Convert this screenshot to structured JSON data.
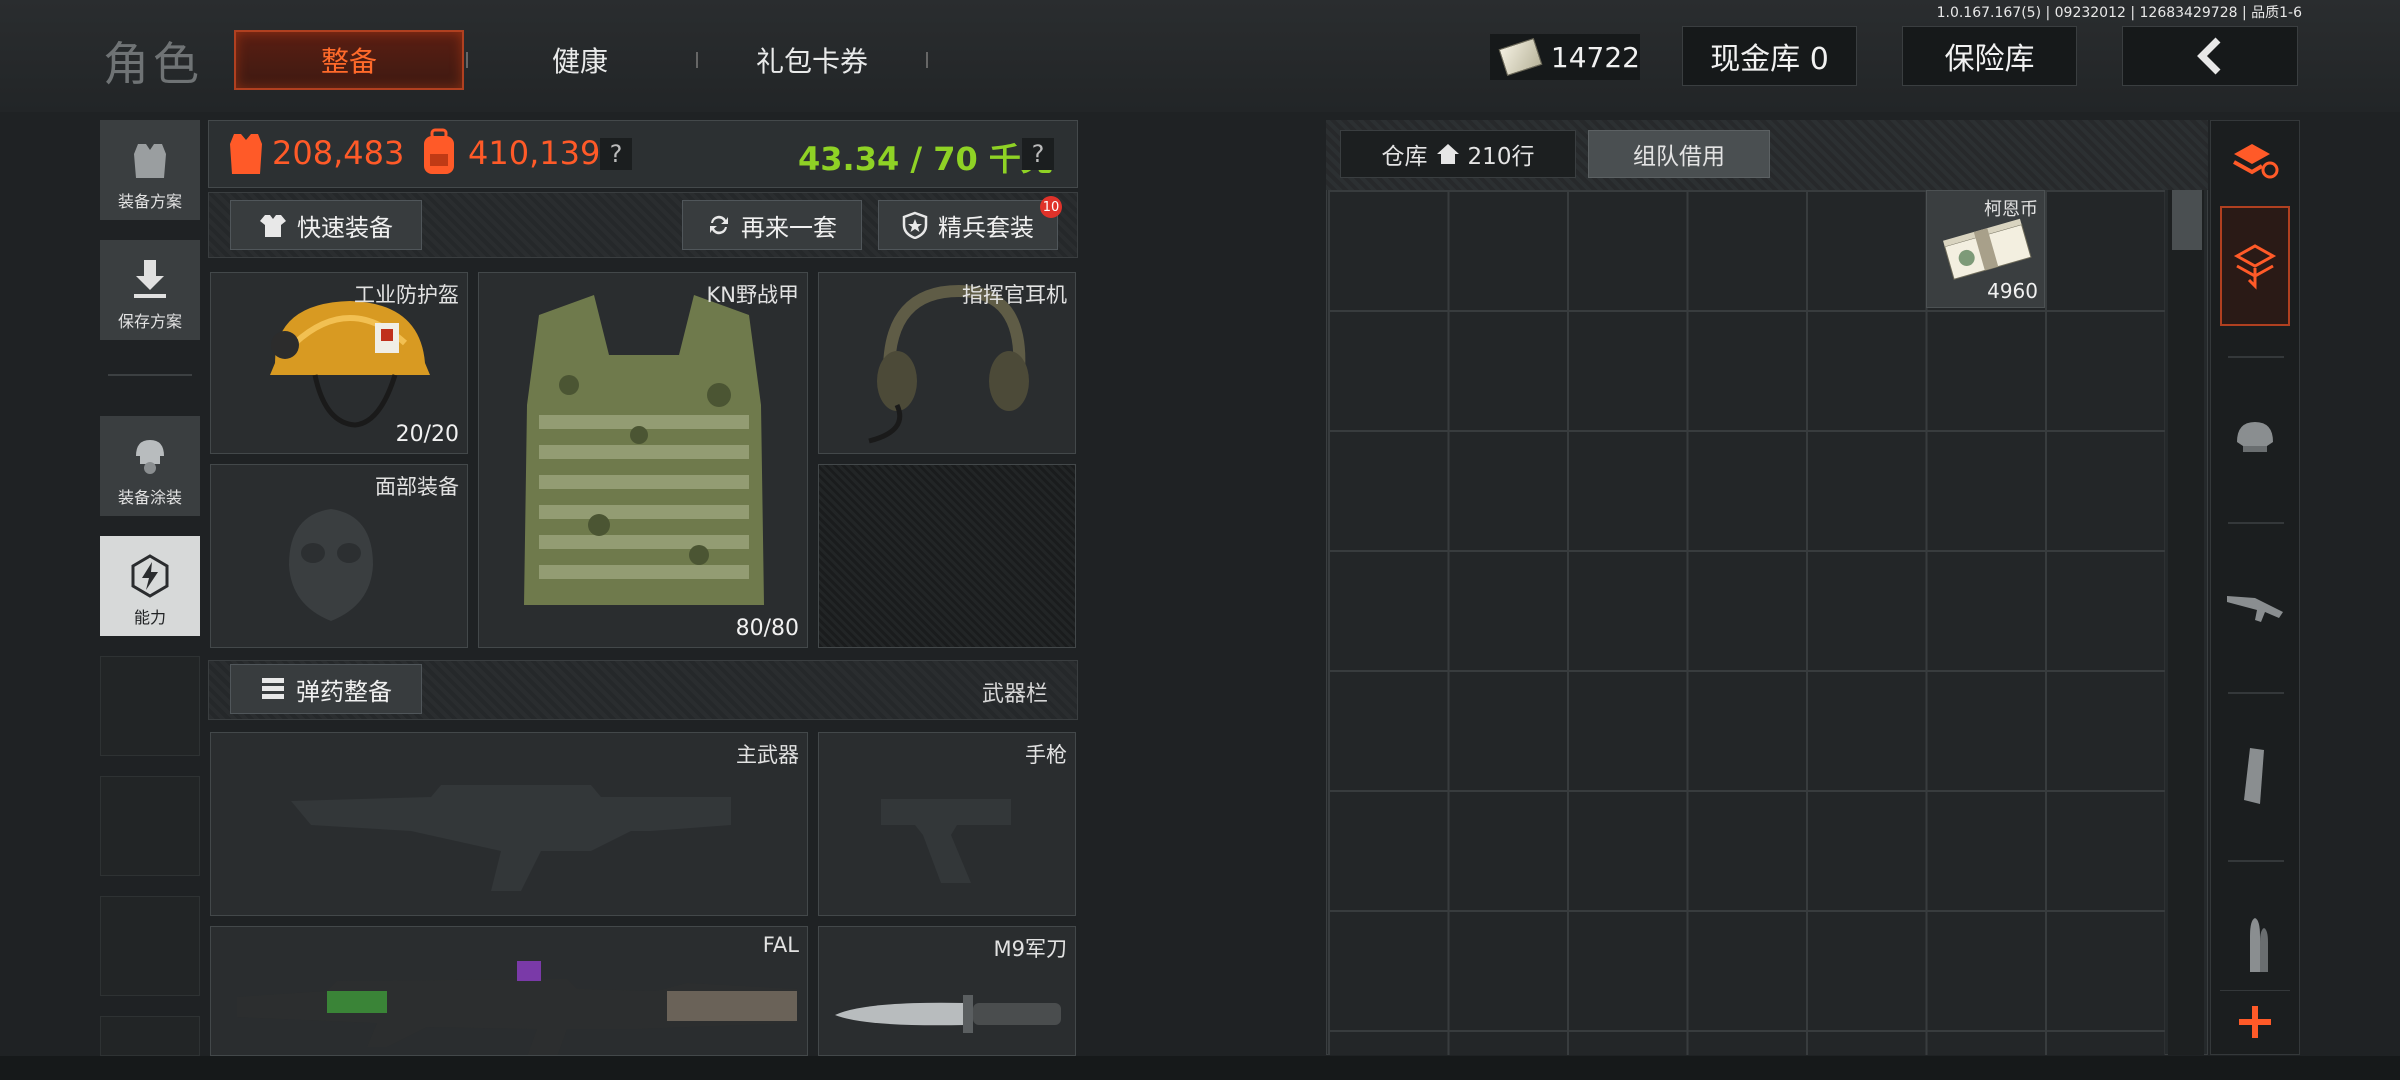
{
  "build_info": "1.0.167.167(5) | 09232012 | 12683429728 | 品质1-6",
  "header": {
    "section_title": "角色",
    "tabs": [
      {
        "label": "整备",
        "active": true
      },
      {
        "label": "健康",
        "active": false
      },
      {
        "label": "礼包卡券",
        "active": false
      }
    ],
    "currency_value": "14722",
    "cash_vault_label": "现金库 0",
    "insurance_label": "保险库"
  },
  "side_menu": [
    {
      "label": "装备方案",
      "icon": "vest-icon"
    },
    {
      "label": "保存方案",
      "icon": "download-icon"
    },
    {
      "label": "装备涂装",
      "icon": "helmet-skin-icon"
    },
    {
      "label": "能力",
      "icon": "ability-icon",
      "active": true
    }
  ],
  "stats": {
    "armor_value": "208,483",
    "backpack_value": "410,139",
    "help": "?",
    "weight_text": "43.34 / 70 千克",
    "weight_help": "?"
  },
  "actions": {
    "quick_equip": "快速装备",
    "another_set": "再来一套",
    "elite_set": "精兵套装",
    "elite_badge": "10"
  },
  "gear_slots": {
    "helmet": {
      "name": "工业防护盔",
      "durability": "20/20"
    },
    "vest": {
      "name": "KN野战甲",
      "durability": "80/80"
    },
    "headset": {
      "name": "指挥官耳机"
    },
    "face": {
      "name": "面部装备"
    }
  },
  "weapon_bar": {
    "ammo_button": "弹药整备",
    "title": "武器栏"
  },
  "weapon_slots": {
    "primary": {
      "name": "主武器"
    },
    "pistol": {
      "name": "手枪"
    },
    "secondary": {
      "name": "FAL"
    },
    "melee": {
      "name": "M9军刀"
    }
  },
  "warehouse": {
    "tab_label": "仓库",
    "rows": "210行",
    "team_borrow": "组队借用",
    "items": [
      {
        "name": "柯恩币",
        "count": "4960"
      }
    ]
  },
  "right_rail": [
    "loadout-refresh-icon",
    "stash-layer-icon",
    "helmet-filter-icon",
    "rifle-filter-icon",
    "magazine-filter-icon",
    "ammo-filter-icon",
    "add-icon"
  ],
  "colors": {
    "accent": "#ff5a28",
    "weight_green": "#8fd225",
    "active_tab_bg": "#4a1c12"
  }
}
